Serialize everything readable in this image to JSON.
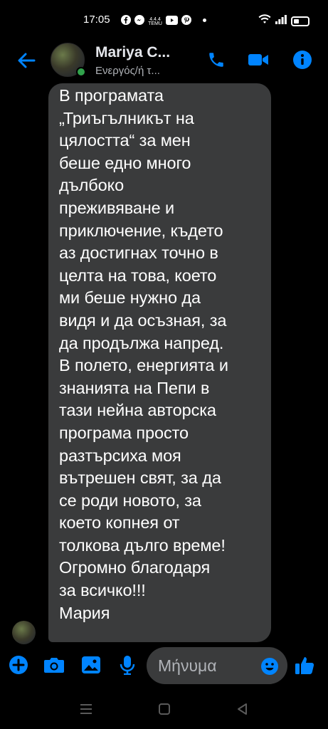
{
  "status_bar": {
    "time": "17:05",
    "notification_icons": [
      "facebook-icon",
      "messenger-icon",
      "temu-icon",
      "youtube-icon",
      "pinterest-icon"
    ],
    "temu_text": "4.4.4\nTEMU",
    "right_icons": [
      "wifi-icon",
      "signal-icon",
      "battery-icon"
    ]
  },
  "header": {
    "contact_name": "Mariya C...",
    "contact_status": "Ενεργός/ή τ...",
    "icons": [
      "back-arrow-icon",
      "phone-icon",
      "video-camera-icon",
      "info-icon"
    ]
  },
  "conversation": {
    "message_text": "В програмата\n„Триъгълникът на\nцялостта“ за мен\nбеше едно много\nдълбоко\nпреживяване и\nприключение, където\nаз достигнах точно в\nцелта на това, което\nми беше нужно да\nвидя и да осъзная, за\nда продължа напред.\nВ полето, енергията и\nзнанията на Пепи в\nтази нейна авторска\nпрограма просто\nразтърсиха моя\nвътрешен свят, за да\nсе роди новото, за\nкоето копнея от\nтолкова дълго време!\nОгромно благодаря\nза всичко!!!\nМария"
  },
  "composer": {
    "placeholder": "Μήνυμα",
    "icons": [
      "plus-icon",
      "camera-icon",
      "image-icon",
      "microphone-icon",
      "emoji-icon",
      "like-icon"
    ]
  },
  "navigation": {
    "icons": [
      "recents-icon",
      "home-icon",
      "back-icon"
    ]
  },
  "colors": {
    "background": "#000000",
    "accent": "#0084ff",
    "bubble": "#3a3b3c",
    "online": "#31a24c"
  }
}
